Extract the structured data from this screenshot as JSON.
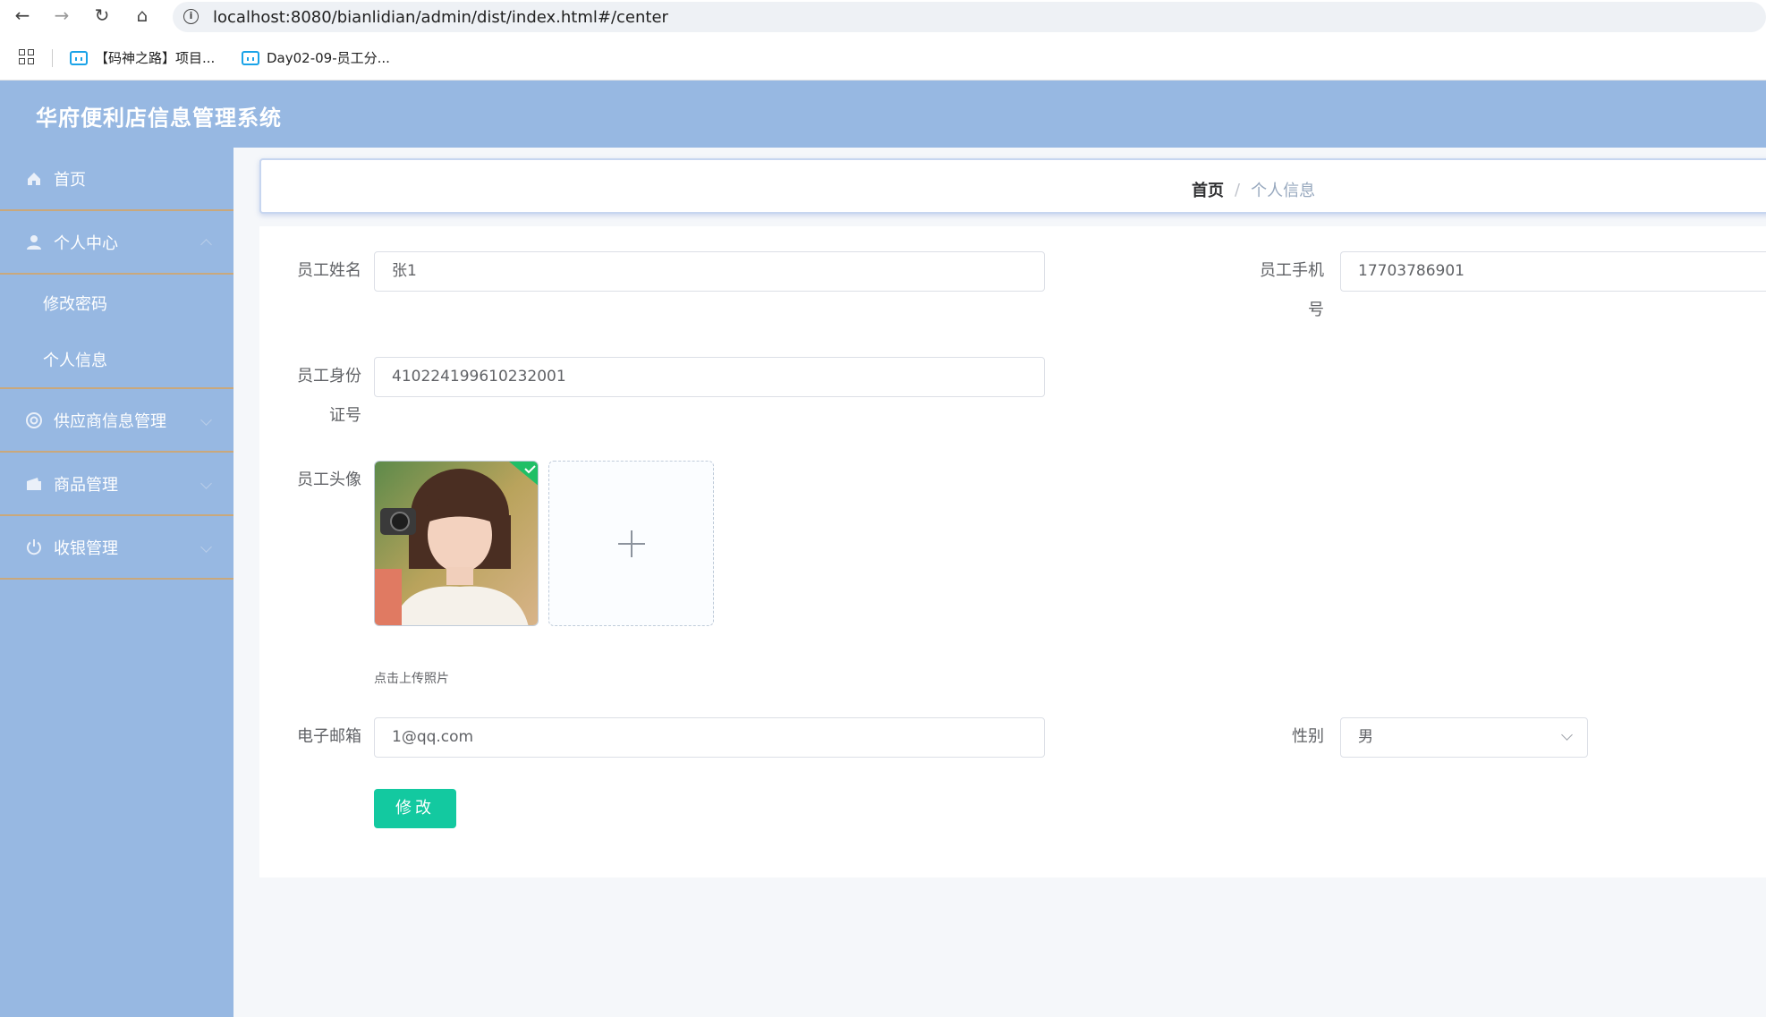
{
  "browser": {
    "url": "localhost:8080/bianlidian/admin/dist/index.html#/center",
    "bookmarks": [
      "【码神之路】项目...",
      "Day02-09-员工分..."
    ]
  },
  "app": {
    "title": "华府便利店信息管理系统"
  },
  "sidebar": {
    "items": [
      {
        "label": "首页",
        "icon": "home-icon"
      },
      {
        "label": "个人中心",
        "icon": "user-icon",
        "children": [
          "修改密码",
          "个人信息"
        ]
      },
      {
        "label": "供应商信息管理",
        "icon": "lifebuoy-icon"
      },
      {
        "label": "商品管理",
        "icon": "wallet-icon"
      },
      {
        "label": "收银管理",
        "icon": "power-icon"
      }
    ]
  },
  "breadcrumb": {
    "home": "首页",
    "separator": "/",
    "current": "个人信息"
  },
  "form": {
    "name_label": "员工姓名",
    "name_value": "张1",
    "phone_label_1": "员工手机",
    "phone_label_2": "号",
    "phone_value": "17703786901",
    "idcard_label_1": "员工身份",
    "idcard_label_2": "证号",
    "idcard_value": "410224199610232001",
    "avatar_label": "员工头像",
    "upload_tip": "点击上传照片",
    "email_label": "电子邮箱",
    "email_value": "1@qq.com",
    "gender_label": "性别",
    "gender_value": "男",
    "submit_label": "修改"
  },
  "colors": {
    "header": "#97b8e2",
    "accent": "#13c9a0"
  }
}
